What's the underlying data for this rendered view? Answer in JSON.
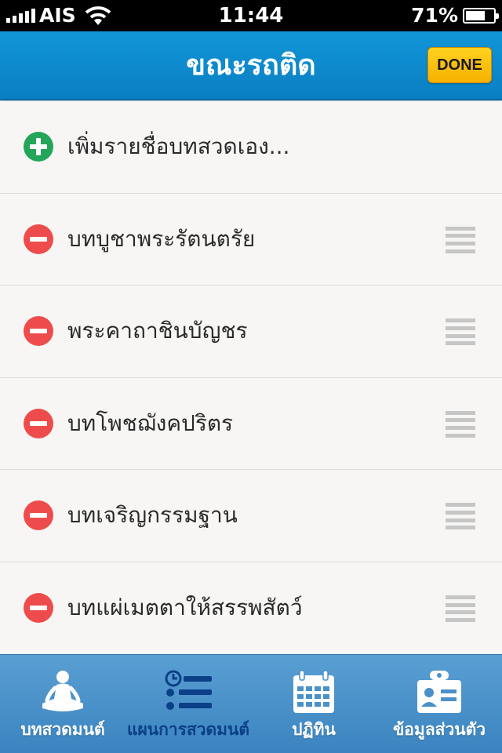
{
  "status_bar": {
    "carrier": "AIS",
    "time": "11:44",
    "battery_percent": "71%",
    "battery_level": 0.71
  },
  "nav": {
    "title": "ขณะรถติด",
    "done_label": "DONE",
    "done_color": "#fcbf0a",
    "bar_color": "#0a86cb"
  },
  "list": {
    "add_item": {
      "label": "เพิ่มรายชื่อบทสวดเอง...",
      "icon": "add-circle-icon"
    },
    "items": [
      {
        "label": "บทบูชาพระรัตนตรัย",
        "icon": "remove-circle-icon"
      },
      {
        "label": "พระคาถาชินบัญชร",
        "icon": "remove-circle-icon"
      },
      {
        "label": "บทโพชฌังคปริตร",
        "icon": "remove-circle-icon"
      },
      {
        "label": "บทเจริญกรรมฐาน",
        "icon": "remove-circle-icon"
      },
      {
        "label": "บทแผ่เมตตาให้สรรพสัตว์",
        "icon": "remove-circle-icon"
      }
    ]
  },
  "tab_bar": {
    "tabs": [
      {
        "label": "บทสวดมนต์",
        "icon": "meditation-icon",
        "active": false
      },
      {
        "label": "แผนการสวดมนต์",
        "icon": "schedule-list-icon",
        "active": true
      },
      {
        "label": "ปฏิทิน",
        "icon": "calendar-icon",
        "active": false
      },
      {
        "label": "ข้อมูลส่วนตัว",
        "icon": "id-card-icon",
        "active": false
      }
    ]
  }
}
